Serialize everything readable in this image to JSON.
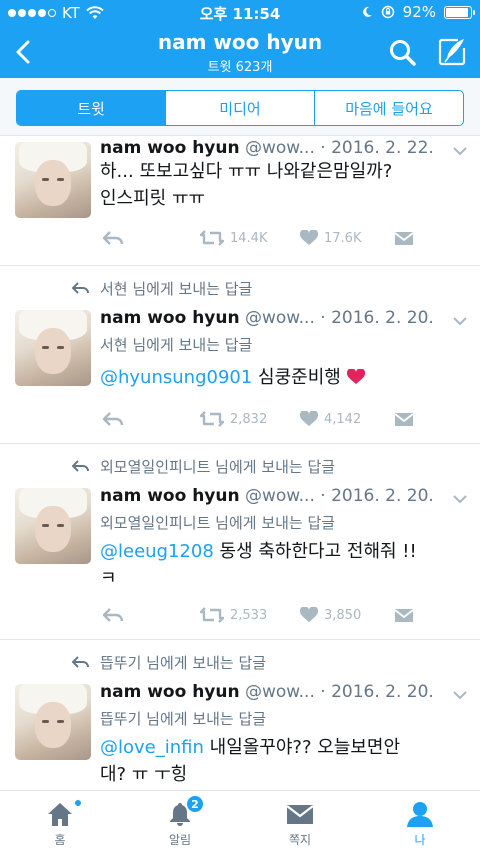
{
  "status": {
    "carrier": "KT",
    "time": "오후 11:54",
    "battery": "92%"
  },
  "nav": {
    "title": "nam woo hyun",
    "subtitle": "트윗 623개",
    "back_icon": "back-chevron-icon",
    "search_icon": "search-icon",
    "compose_icon": "compose-tweet-icon"
  },
  "tabs": [
    {
      "label": "트윗",
      "active": true
    },
    {
      "label": "미디어",
      "active": false
    },
    {
      "label": "마음에 들어요",
      "active": false
    }
  ],
  "tweets": [
    {
      "name": "nam woo hyun",
      "handle": "@wow...",
      "date": "2016. 2. 22.",
      "reply_context": "",
      "reply_line": "",
      "mention": "",
      "text_line1": "하... 또보고싶다 ㅠㅠ 나와같은맘일까?",
      "text_line2": "인스피릿 ㅠㅠ",
      "retweets": "14.4K",
      "likes": "17.6K"
    },
    {
      "name": "nam woo hyun",
      "handle": "@wow...",
      "date": "2016. 2. 20.",
      "reply_context": "서현 님에게 보내는 답글",
      "reply_line": "서현 님에게 보내는 답글",
      "mention": "@hyunsung0901",
      "text_line1": " 심쿵준비행",
      "text_line2": "",
      "retweets": "2,832",
      "likes": "4,142"
    },
    {
      "name": "nam woo hyun",
      "handle": "@wow...",
      "date": "2016. 2. 20.",
      "reply_context": "외모열일인피니트 님에게 보내는 답글",
      "reply_line": "외모열일인피니트 님에게 보내는 답글",
      "mention": "@leeug1208",
      "text_line1": " 동생 축하한다고 전해줘 !!",
      "text_line2": "ㅋ",
      "retweets": "2,533",
      "likes": "3,850"
    },
    {
      "name": "nam woo hyun",
      "handle": "@wow...",
      "date": "2016. 2. 20.",
      "reply_context": "뜹뚜기 님에게 보내는 답글",
      "reply_line": "뜹뚜기 님에게 보내는 답글",
      "mention": "@love_infin",
      "text_line1": " 내일올꾸야?? 오늘보면안",
      "text_line2": "대? ㅠ ㅜ힝",
      "retweets": "",
      "likes": ""
    }
  ],
  "tabbar": [
    {
      "label": "홈",
      "icon": "home-icon",
      "badge": ""
    },
    {
      "label": "알림",
      "icon": "bell-icon",
      "badge": "2"
    },
    {
      "label": "쪽지",
      "icon": "envelope-icon",
      "badge": ""
    },
    {
      "label": "나",
      "icon": "person-icon",
      "badge": ""
    }
  ],
  "colors": {
    "brand": "#1da1f2",
    "muted": "#657786",
    "action_gray": "#aab8c2"
  }
}
